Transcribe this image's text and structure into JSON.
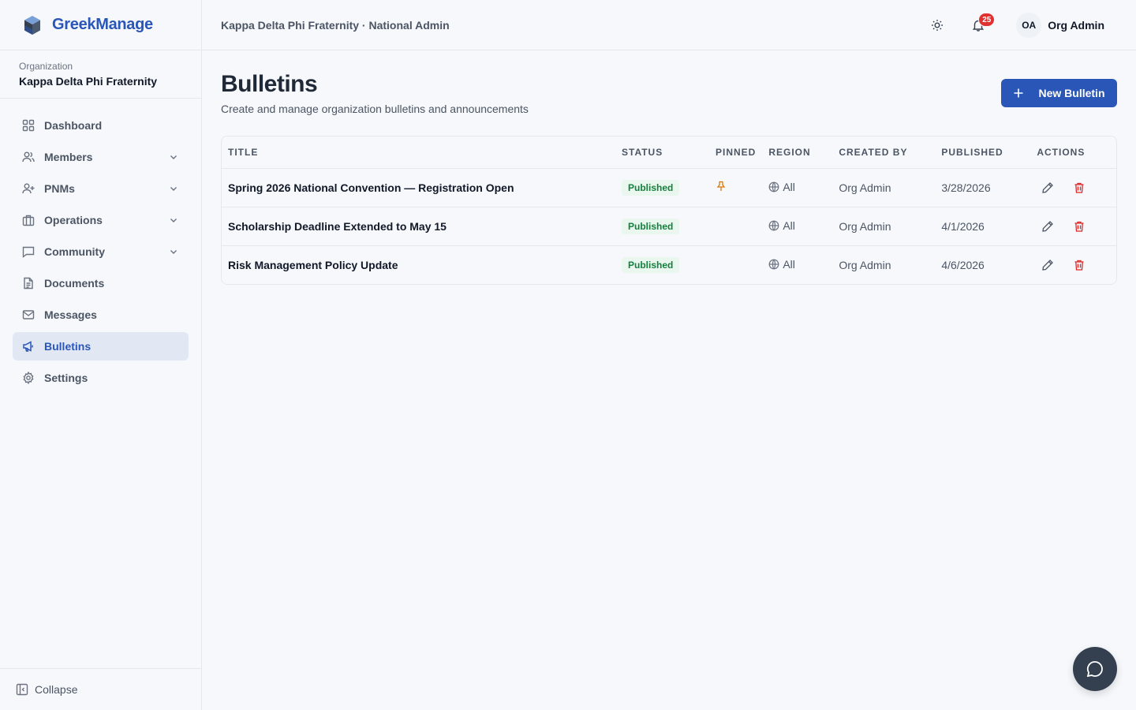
{
  "app": {
    "name": "GreekManage"
  },
  "organization": {
    "label": "Organization",
    "name": "Kappa Delta Phi Fraternity"
  },
  "sidebar": {
    "items": [
      {
        "label": "Dashboard"
      },
      {
        "label": "Members"
      },
      {
        "label": "PNMs"
      },
      {
        "label": "Operations"
      },
      {
        "label": "Community"
      },
      {
        "label": "Documents"
      },
      {
        "label": "Messages"
      },
      {
        "label": "Bulletins"
      },
      {
        "label": "Settings"
      }
    ],
    "collapse_label": "Collapse"
  },
  "topbar": {
    "breadcrumb": "Kappa Delta Phi Fraternity · National Admin",
    "notification_count": "25",
    "user_initials": "OA",
    "user_name": "Org Admin"
  },
  "page": {
    "title": "Bulletins",
    "subtitle": "Create and manage organization bulletins and announcements",
    "new_button_label": "New Bulletin"
  },
  "table": {
    "columns": [
      "TITLE",
      "STATUS",
      "PINNED",
      "REGION",
      "CREATED BY",
      "PUBLISHED",
      "ACTIONS"
    ],
    "rows": [
      {
        "title": "Spring 2026 National Convention — Registration Open",
        "status": "Published",
        "pinned": true,
        "region": "All",
        "created_by": "Org Admin",
        "published": "3/28/2026"
      },
      {
        "title": "Scholarship Deadline Extended to May 15",
        "status": "Published",
        "pinned": false,
        "region": "All",
        "created_by": "Org Admin",
        "published": "4/1/2026"
      },
      {
        "title": "Risk Management Policy Update",
        "status": "Published",
        "pinned": false,
        "region": "All",
        "created_by": "Org Admin",
        "published": "4/6/2026"
      }
    ]
  },
  "colors": {
    "accent": "#2a56b8",
    "danger": "#dc2626",
    "success": "#15803d",
    "pin": "#d97706"
  }
}
